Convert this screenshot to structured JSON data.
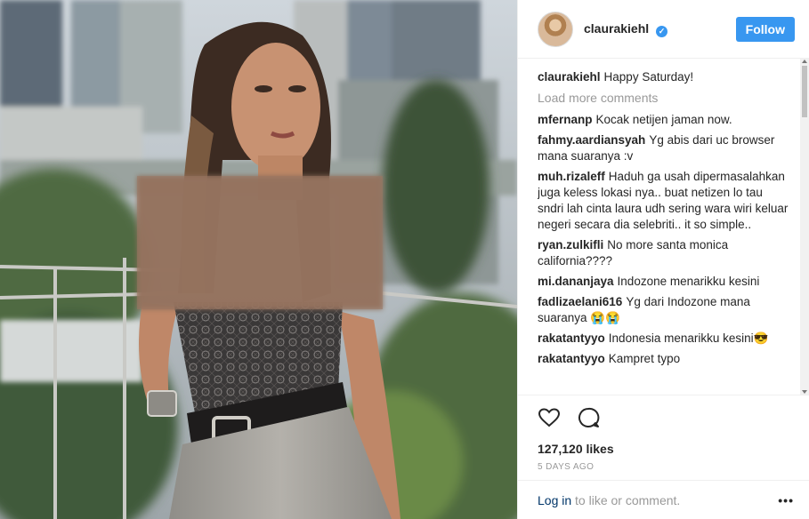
{
  "post": {
    "username": "claurakiehl",
    "follow_label": "Follow",
    "caption_user": "claurakiehl",
    "caption_text": "Happy Saturday!",
    "load_more": "Load more comments",
    "comments": [
      {
        "user": "mfernanp",
        "text": "Kocak netijen jaman now."
      },
      {
        "user": "fahmy.aardiansyah",
        "text": "Yg abis dari uc browser mana suaranya :v"
      },
      {
        "user": "muh.rizaleff",
        "text": "Haduh ga usah dipermasalahkan juga keless lokasi nya.. buat netizen lo tau sndri lah cinta laura udh sering wara wiri keluar negeri secara dia selebriti.. it so simple.."
      },
      {
        "user": "ryan.zulkifli",
        "text": "No more santa monica california????"
      },
      {
        "user": "mi.dananjaya",
        "text": "Indozone menarikku kesini"
      },
      {
        "user": "fadlizaelani616",
        "text": "Yg dari Indozone mana suaranya 😭😭"
      },
      {
        "user": "rakatantyyo",
        "text": "Indonesia menarikku kesini😎"
      },
      {
        "user": "rakatantyyo",
        "text": "Kampret typo"
      }
    ],
    "likes": "127,120 likes",
    "time": "5 DAYS AGO",
    "login_link": "Log in",
    "login_rest": " to like or comment.",
    "more_dots": "•••",
    "icons": {
      "like": "heart-icon",
      "comment": "comment-bubble-icon",
      "verified": "verified-badge-icon",
      "more": "more-options-icon"
    },
    "colors": {
      "accent": "#3897f0",
      "text": "#262626",
      "muted": "#999999",
      "link": "#003569"
    }
  }
}
